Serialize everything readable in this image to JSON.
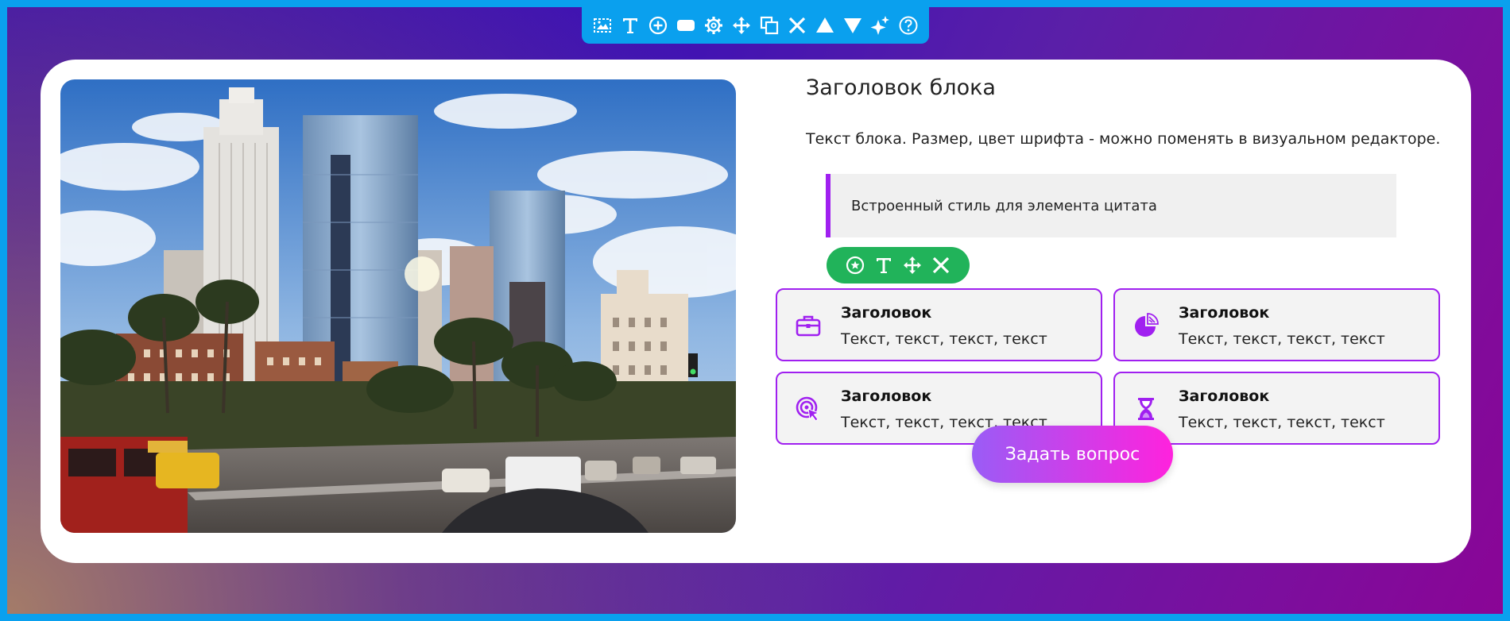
{
  "toolbar": {
    "icons": [
      "image-settings-icon",
      "text-icon",
      "add-block-icon",
      "button-element-icon",
      "gear-icon",
      "move-icon",
      "duplicate-icon",
      "close-icon",
      "move-up-icon",
      "move-down-icon",
      "magic-icon",
      "help-icon"
    ]
  },
  "block": {
    "title": "Заголовок блока",
    "text": "Текст блока. Размер, цвет шрифта - можно поменять в визуальном редакторе.",
    "quote": "Встроенный стиль для элемента цитата"
  },
  "features": [
    {
      "heading": "Заголовок",
      "text": "Текст, текст, текст, текст",
      "icon": "briefcase-icon"
    },
    {
      "heading": "Заголовок",
      "text": "Текст, текст, текст, текст",
      "icon": "pie-chart-icon"
    },
    {
      "heading": "Заголовок",
      "text": "Текст, текст, текст, текст",
      "icon": "target-click-icon"
    },
    {
      "heading": "Заголовок",
      "text": "Текст, текст, текст, текст",
      "icon": "hourglass-icon"
    }
  ],
  "mini_toolbar": {
    "icons": [
      "star-circle-icon",
      "text-icon",
      "move-icon",
      "close-icon"
    ]
  },
  "cta": {
    "label": "Задать вопрос"
  },
  "colors": {
    "accent": "#a020f0",
    "toolbar_bg": "#0aa0ee",
    "mini_toolbar_bg": "#21b35a",
    "cta_gradient_start": "#9a5cf6",
    "cta_gradient_end": "#ff22dd"
  }
}
